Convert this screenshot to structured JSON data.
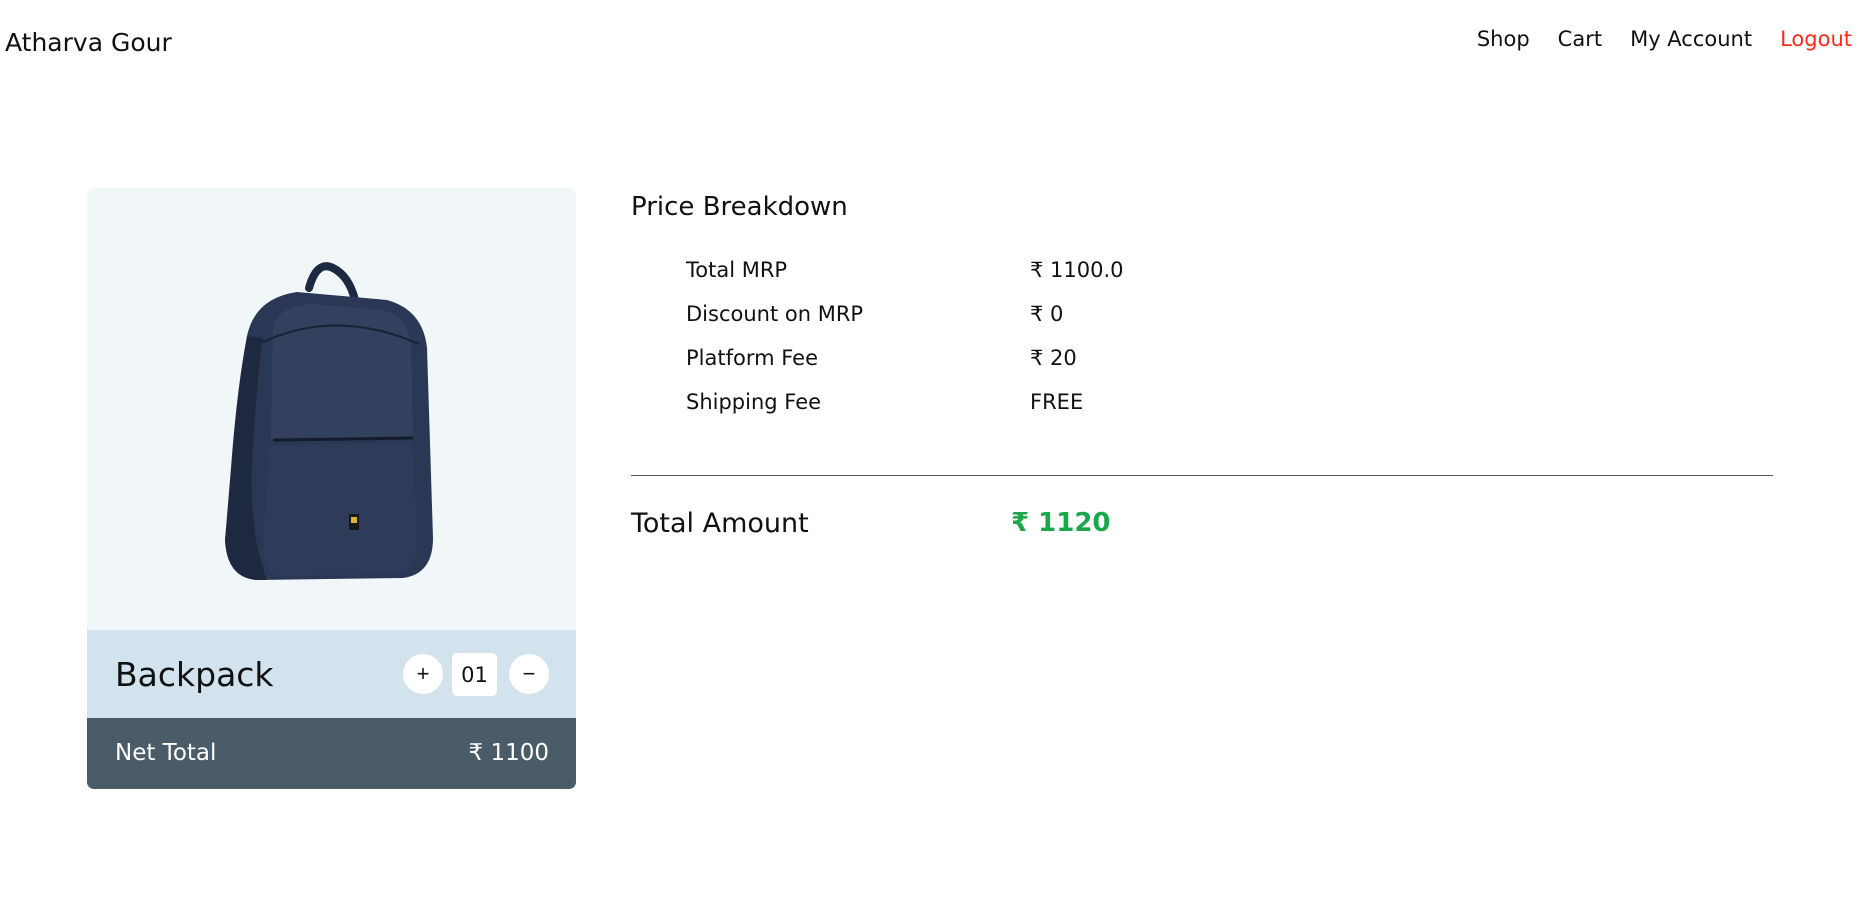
{
  "nav": {
    "brand": "Atharva Gour",
    "links": [
      "Shop",
      "Cart",
      "My Account",
      "Logout"
    ],
    "logout_color": "#ff2a1a"
  },
  "cart_item": {
    "name": "Backpack",
    "quantity": "01",
    "plus_label": "+",
    "minus_label": "−",
    "net_total_label": "Net Total",
    "net_total_value": "₹ 1100",
    "image_icon": "backpack-image"
  },
  "breakdown": {
    "title": "Price Breakdown",
    "rows": [
      {
        "label": "Total MRP",
        "value": "₹ 1100.0"
      },
      {
        "label": "Discount on MRP",
        "value": "₹ 0"
      },
      {
        "label": "Platform Fee",
        "value": "₹ 20"
      },
      {
        "label": "Shipping Fee",
        "value": "FREE"
      }
    ],
    "total_label": "Total Amount",
    "total_value": "₹ 1120",
    "total_color": "#1aa84a"
  }
}
